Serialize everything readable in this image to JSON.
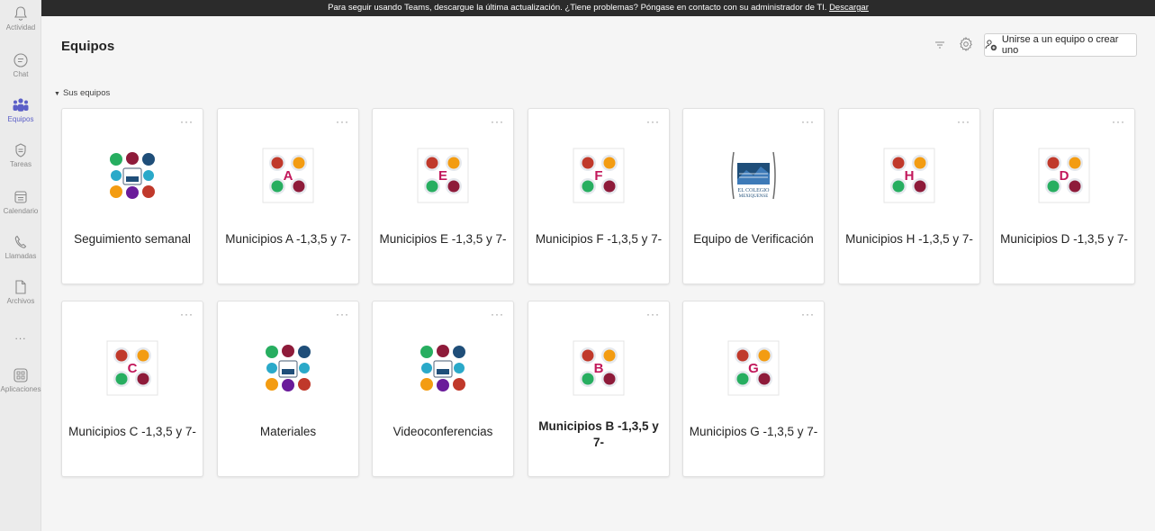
{
  "rail": {
    "items": [
      {
        "label": "Actividad",
        "icon": "bell-icon"
      },
      {
        "label": "Chat",
        "icon": "chat-icon"
      },
      {
        "label": "Equipos",
        "icon": "teams-icon"
      },
      {
        "label": "Tareas",
        "icon": "tasks-icon"
      },
      {
        "label": "Calendario",
        "icon": "calendar-icon"
      },
      {
        "label": "Llamadas",
        "icon": "phone-icon"
      },
      {
        "label": "Archivos",
        "icon": "file-icon"
      },
      {
        "label": "...",
        "icon": "more-icon"
      },
      {
        "label": "Aplicaciones",
        "icon": "apps-icon"
      }
    ]
  },
  "banner": {
    "text": "Para seguir usando Teams, descargue la última actualización. ¿Tiene problemas? Póngase en contacto con su administrador de TI.",
    "link": "Descargar"
  },
  "header": {
    "title": "Equipos",
    "join_button": "Unirse a un equipo o crear uno"
  },
  "section": {
    "label": "Sus equipos"
  },
  "teams": [
    {
      "name": "Seguimiento semanal",
      "logo": "circles",
      "bold": false
    },
    {
      "name": "Municipios A -1,3,5 y 7-",
      "logo": "municipio",
      "letter": "A",
      "bold": false
    },
    {
      "name": "Municipios E -1,3,5 y 7-",
      "logo": "municipio",
      "letter": "E",
      "bold": false
    },
    {
      "name": "Municipios F -1,3,5 y 7-",
      "logo": "municipio",
      "letter": "F",
      "bold": false
    },
    {
      "name": "Equipo de Verificación",
      "logo": "colegio",
      "bold": false
    },
    {
      "name": "Municipios H -1,3,5 y 7-",
      "logo": "municipio",
      "letter": "H",
      "bold": false
    },
    {
      "name": "Municipios D -1,3,5 y 7-",
      "logo": "municipio",
      "letter": "D",
      "bold": false
    },
    {
      "name": "Municipios C -1,3,5 y 7-",
      "logo": "municipio",
      "letter": "C",
      "bold": false
    },
    {
      "name": "Materiales",
      "logo": "circles",
      "bold": false
    },
    {
      "name": "Videoconferencias",
      "logo": "circles",
      "bold": false
    },
    {
      "name": "Municipios B -1,3,5 y 7-",
      "logo": "municipio",
      "letter": "B",
      "bold": true
    },
    {
      "name": "Municipios G -1,3,5 y 7-",
      "logo": "municipio",
      "letter": "G",
      "bold": false
    }
  ],
  "colors": {
    "accent": "#5b5fc7",
    "letter": "#c2185b",
    "red": "#c0392b",
    "orange": "#f39c12",
    "green": "#27ae60",
    "teal": "#2aa9c9",
    "maroon": "#8e1b3a",
    "purple": "#6a1b9a",
    "navy": "#1f4e79"
  },
  "card_more_label": "···"
}
